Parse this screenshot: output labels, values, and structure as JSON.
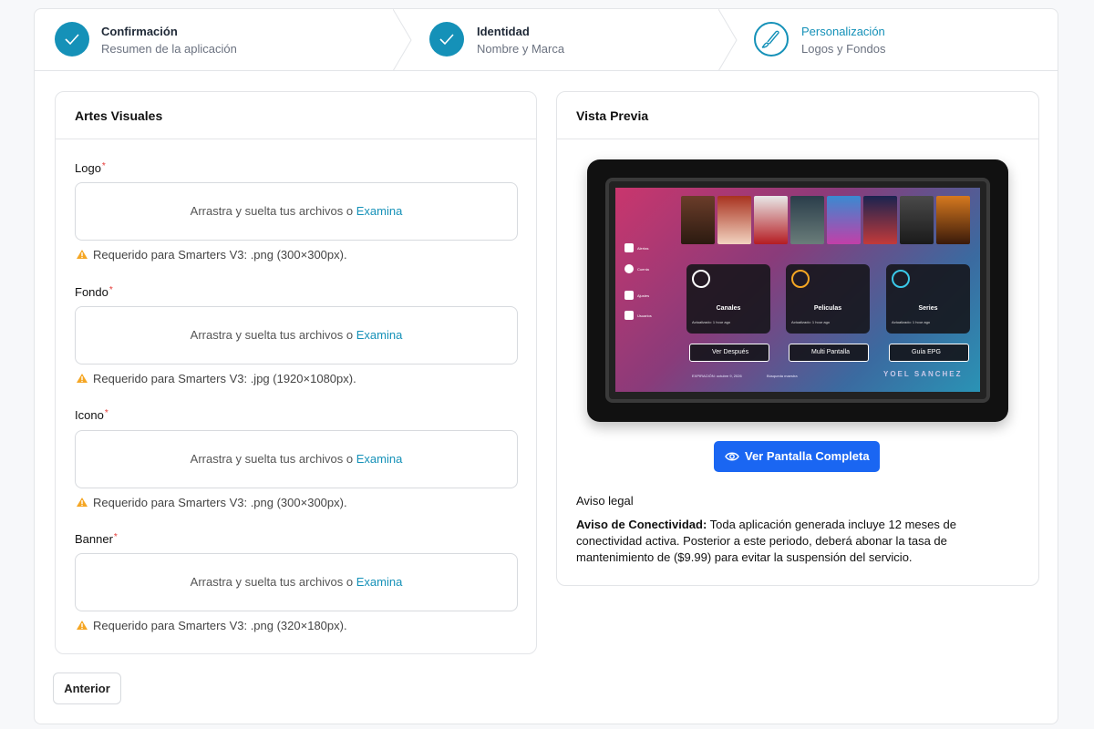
{
  "steps": [
    {
      "title": "Confirmación",
      "subtitle": "Resumen de la aplicación",
      "state": "done"
    },
    {
      "title": "Identidad",
      "subtitle": "Nombre y Marca",
      "state": "done"
    },
    {
      "title": "Personalización",
      "subtitle": "Logos y Fondos",
      "state": "current"
    }
  ],
  "visuals": {
    "title": "Artes Visuales",
    "drop_text": "Arrastra y suelta tus archivos o ",
    "browse": "Examina",
    "required_mark": "*",
    "fields": [
      {
        "label": "Logo",
        "hint": "Requerido para Smarters V3: .png (300×300px)."
      },
      {
        "label": "Fondo",
        "hint": "Requerido para Smarters V3: .jpg (1920×1080px)."
      },
      {
        "label": "Icono",
        "hint": "Requerido para Smarters V3: .png (300×300px)."
      },
      {
        "label": "Banner",
        "hint": "Requerido para Smarters V3: .png (320×180px)."
      }
    ]
  },
  "preview": {
    "title": "Vista Previa",
    "screen": {
      "sidebar": [
        "Alertas",
        "Cuenta",
        "Ajustes",
        "Usuarios"
      ],
      "tiles": [
        {
          "name": "Canales",
          "updated": "Actualizado: 1 hour ago"
        },
        {
          "name": "Peliculas",
          "updated": "Actualizado: 1 hour ago"
        },
        {
          "name": "Series",
          "updated": "Actualizado: 1 hour ago"
        }
      ],
      "buttons": [
        "Ver Después",
        "Multi Pantalla",
        "Guía EPG"
      ],
      "expiry": "EXPIRACIÓN: octubre 9, 2026",
      "search": "Búsqueda maestra",
      "brand": "YOEL SANCHEZ"
    },
    "full_button": "Ver Pantalla Completa",
    "legal_heading": "Aviso legal",
    "legal_bold": "Aviso de Conectividad:",
    "legal_text": " Toda aplicación generada incluye 12 meses de conectividad activa. Posterior a este periodo, deberá abonar la tasa de mantenimiento de ($9.99) para evitar la suspensión del servicio."
  },
  "nav": {
    "previous": "Anterior"
  },
  "colors": {
    "accent": "#1591b8",
    "primary_button": "#1a66f2",
    "required": "#e53935",
    "warning": "#f5a623"
  }
}
